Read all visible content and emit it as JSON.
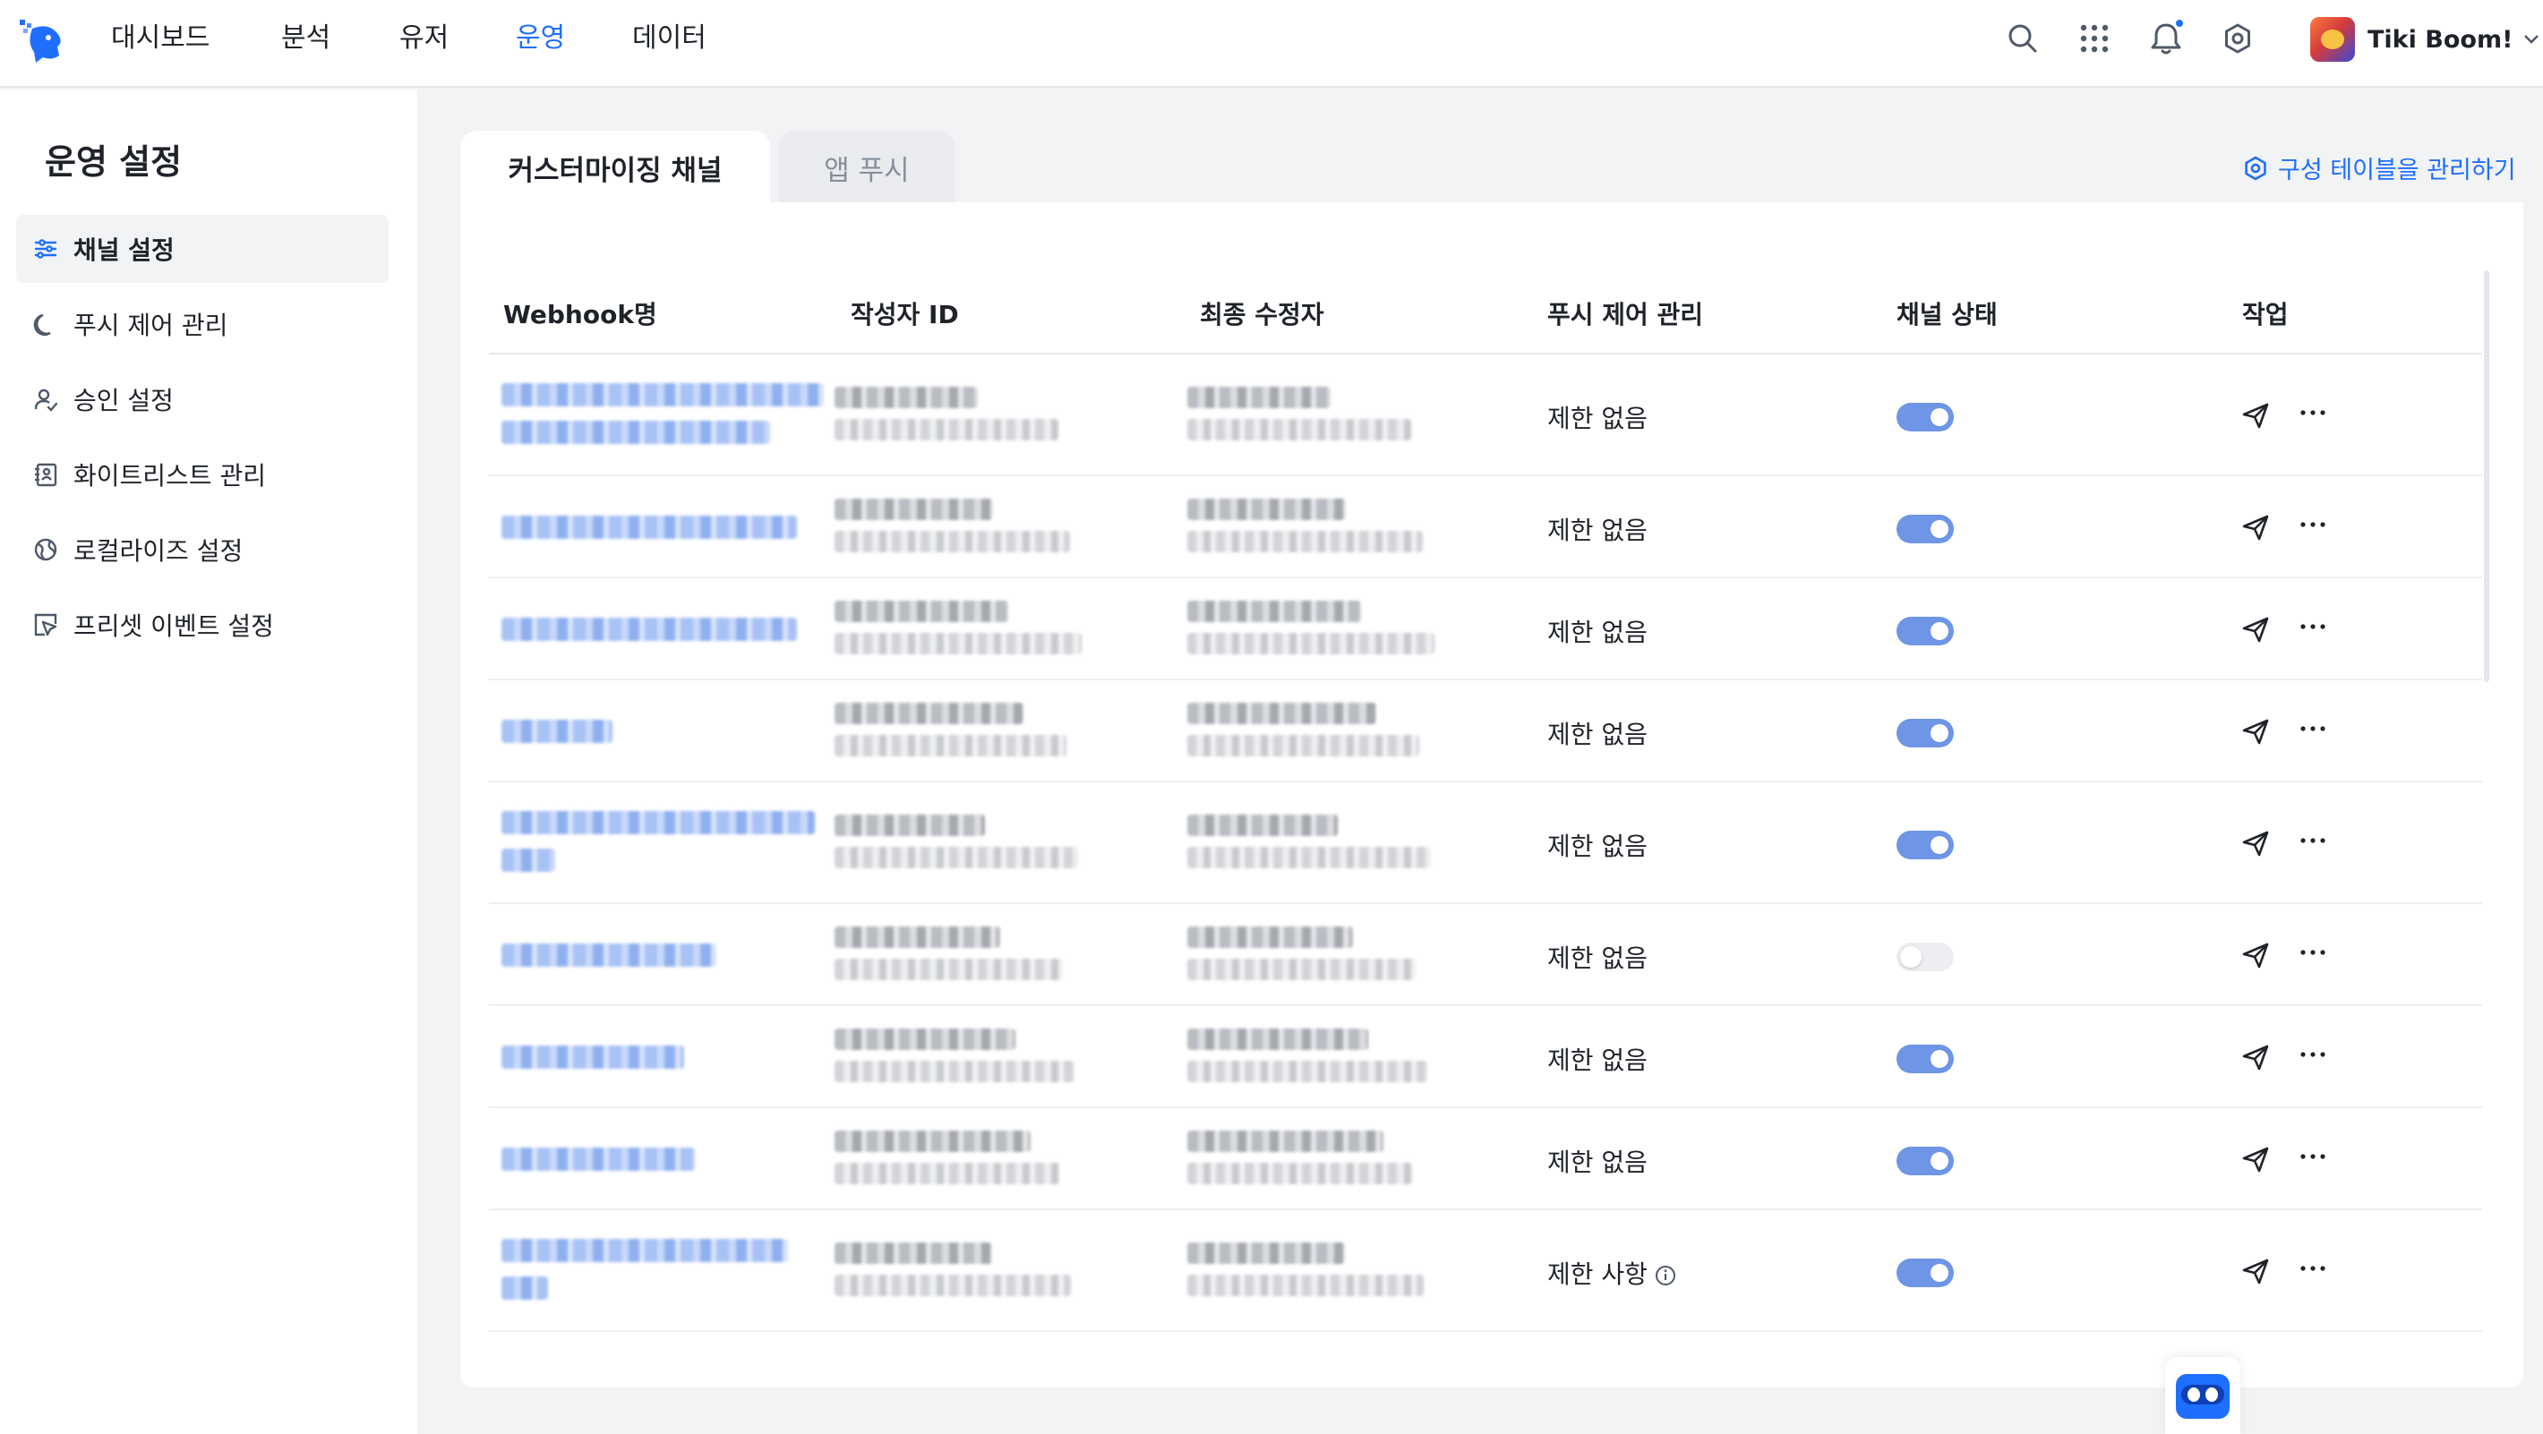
{
  "topnav": {
    "menu": [
      "대시보드",
      "분석",
      "유저",
      "운영",
      "데이터"
    ],
    "active_index": 3,
    "icons": [
      "search-icon",
      "apps-grid-icon",
      "bell-icon",
      "gear-icon"
    ],
    "user_name": "Tiki Boom!"
  },
  "sidebar": {
    "title": "운영 설정",
    "items": [
      {
        "label": "채널 설정",
        "icon": "sliders-icon",
        "active": true
      },
      {
        "label": "푸시 제어 관리",
        "icon": "moon-icon",
        "active": false
      },
      {
        "label": "승인 설정",
        "icon": "user-check-icon",
        "active": false
      },
      {
        "label": "화이트리스트 관리",
        "icon": "contact-card-icon",
        "active": false
      },
      {
        "label": "로컬라이즈 설정",
        "icon": "globe-icon",
        "active": false
      },
      {
        "label": "프리셋 이벤트 설정",
        "icon": "cursor-box-icon",
        "active": false
      }
    ]
  },
  "tabs": [
    {
      "label": "커스터마이징 채널",
      "active": true
    },
    {
      "label": "앱 푸시",
      "active": false
    }
  ],
  "manage_link": "구성 테이블을 관리하기",
  "table": {
    "columns": [
      "Webhook명",
      "작성자 ID",
      "최종 수정자",
      "푸시 제어 관리",
      "채널 상태",
      "작업"
    ],
    "rows": [
      {
        "push_control": "제한 없음",
        "enabled": true,
        "info": false
      },
      {
        "push_control": "제한 없음",
        "enabled": true,
        "info": false
      },
      {
        "push_control": "제한 없음",
        "enabled": true,
        "info": false
      },
      {
        "push_control": "제한 없음",
        "enabled": true,
        "info": false
      },
      {
        "push_control": "제한 없음",
        "enabled": true,
        "info": false
      },
      {
        "push_control": "제한 없음",
        "enabled": false,
        "info": false
      },
      {
        "push_control": "제한 없음",
        "enabled": true,
        "info": false
      },
      {
        "push_control": "제한 없음",
        "enabled": true,
        "info": false
      },
      {
        "push_control": "제한 사항",
        "enabled": true,
        "info": true
      }
    ]
  },
  "colors": {
    "accent": "#1e6fff",
    "toggle_on": "#6e95e6",
    "toggle_off": "#eceef1"
  }
}
